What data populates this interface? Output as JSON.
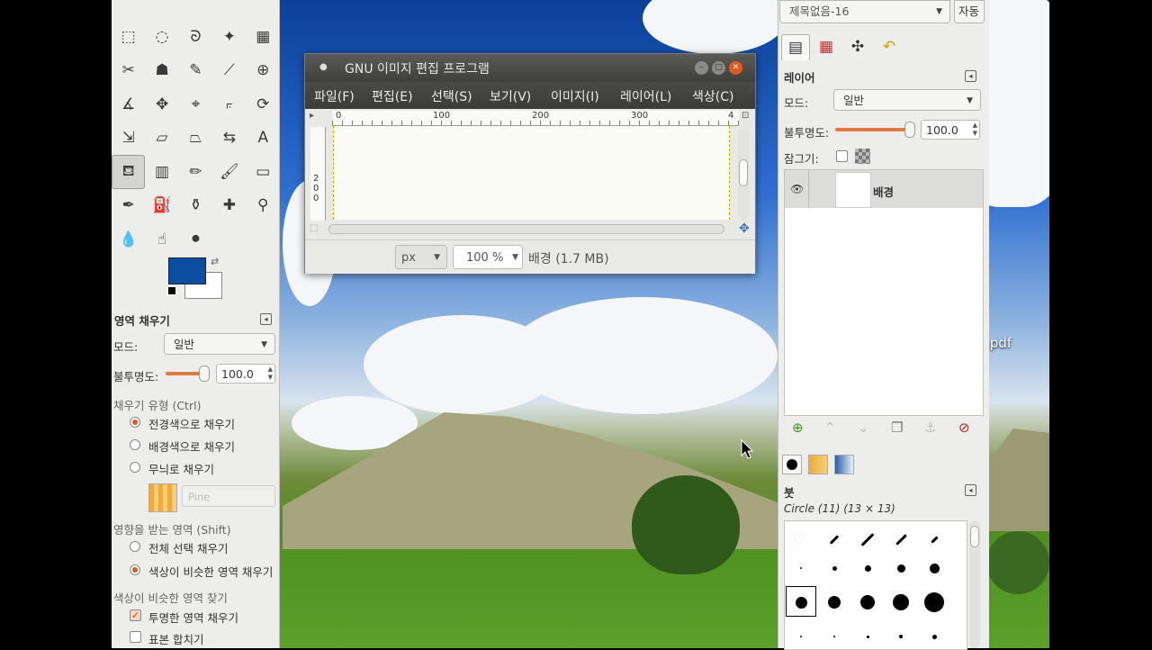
{
  "desktop": {
    "file_label": ".pdf"
  },
  "toolbox": {
    "tools": [
      {
        "icon": "rect-select-icon",
        "glyph": "⬚"
      },
      {
        "icon": "ellipse-select-icon",
        "glyph": "◌"
      },
      {
        "icon": "free-select-icon",
        "glyph": "ᘐ"
      },
      {
        "icon": "fuzzy-select-icon",
        "glyph": "✦"
      },
      {
        "icon": "color-select-icon",
        "glyph": "▦"
      },
      {
        "icon": "scissors-select-icon",
        "glyph": "✂"
      },
      {
        "icon": "foreground-select-icon",
        "glyph": "☗"
      },
      {
        "icon": "paths-icon",
        "glyph": "✎"
      },
      {
        "icon": "color-picker-icon",
        "glyph": "⟋"
      },
      {
        "icon": "zoom-icon",
        "glyph": "⊕"
      },
      {
        "icon": "measure-icon",
        "glyph": "∡"
      },
      {
        "icon": "move-icon",
        "glyph": "✥"
      },
      {
        "icon": "align-icon",
        "glyph": "⌖"
      },
      {
        "icon": "crop-icon",
        "glyph": "⟔"
      },
      {
        "icon": "rotate-icon",
        "glyph": "⟳"
      },
      {
        "icon": "scale-icon",
        "glyph": "⇲"
      },
      {
        "icon": "shear-icon",
        "glyph": "▱"
      },
      {
        "icon": "perspective-icon",
        "glyph": "⏢"
      },
      {
        "icon": "flip-icon",
        "glyph": "⇆"
      },
      {
        "icon": "text-icon",
        "glyph": "A"
      },
      {
        "icon": "bucket-fill-icon",
        "glyph": "⛾"
      },
      {
        "icon": "blend-icon",
        "glyph": "▥"
      },
      {
        "icon": "pencil-icon",
        "glyph": "✏"
      },
      {
        "icon": "paintbrush-icon",
        "glyph": "🖌"
      },
      {
        "icon": "eraser-icon",
        "glyph": "▭"
      },
      {
        "icon": "airbrush-icon",
        "glyph": "✒"
      },
      {
        "icon": "ink-icon",
        "glyph": "⛽"
      },
      {
        "icon": "clone-icon",
        "glyph": "⚱"
      },
      {
        "icon": "heal-icon",
        "glyph": "✚"
      },
      {
        "icon": "perspective-clone-icon",
        "glyph": "⚲"
      },
      {
        "icon": "blur-icon",
        "glyph": "💧"
      },
      {
        "icon": "smudge-icon",
        "glyph": "☝"
      },
      {
        "icon": "dodge-burn-icon",
        "glyph": "⚫"
      }
    ],
    "colors": {
      "foreground": "#0b4ea2",
      "background": "#ffffff"
    }
  },
  "tool_options": {
    "title": "영역 채우기",
    "mode_label": "모드:",
    "mode_value": "일반",
    "opacity_label": "불투명도:",
    "opacity_value": "100.0",
    "opacity": 1.0,
    "fill_type_label": "채우기 유형 (Ctrl)",
    "fill_fg": "전경색으로 채우기",
    "fill_bg": "배경색으로 채우기",
    "fill_pattern": "무늬로 채우기",
    "pattern_name": "Pine",
    "affected_label": "영향을 받는 영역 (Shift)",
    "affected_all": "전체 선택 채우기",
    "affected_similar": "색상이 비슷한 영역 채우기",
    "find_similar_label": "색상이 비슷한 영역 찾기",
    "fill_transparent": "투명한 영역 채우기",
    "sample_merged": "표본 합치기"
  },
  "image_window": {
    "title": "GNU 이미지 편집 프로그램",
    "menus": [
      "파일(F)",
      "편집(E)",
      "선택(S)",
      "보기(V)",
      "이미지(I)",
      "레이어(L)",
      "색상(C)"
    ],
    "ruler_h": [
      "0",
      "100",
      "200",
      "300",
      "4"
    ],
    "ruler_v": [
      "2",
      "0",
      "0"
    ],
    "unit": "px",
    "zoom": "100 %",
    "status": "배경 (1.7 MB)"
  },
  "dock": {
    "image_select": "제목없음-16",
    "auto_button": "자동",
    "layers_title": "레이어",
    "mode_label": "모드:",
    "mode_value": "일반",
    "opacity_label": "불투명도:",
    "opacity_value": "100.0",
    "opacity": 1.0,
    "lock_label": "잠그기:",
    "layers": [
      {
        "name": "배경"
      }
    ],
    "brushes_title": "붓",
    "brush_info": "Circle (11) (13 × 13)"
  }
}
